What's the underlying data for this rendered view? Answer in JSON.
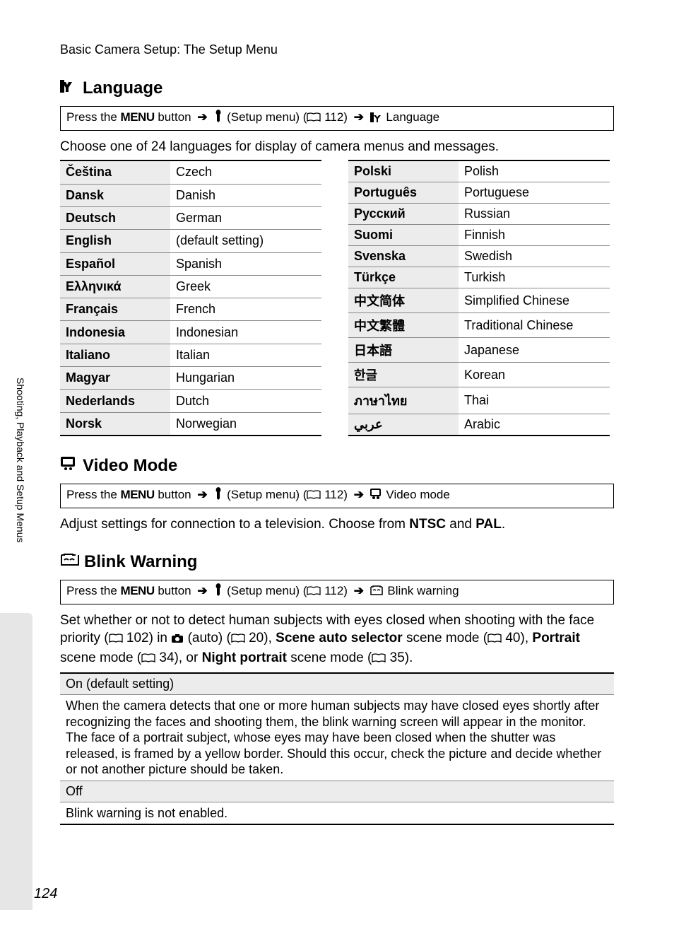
{
  "header": "Basic Camera Setup: The Setup Menu",
  "side_label": "Shooting, Playback and Setup Menus",
  "page_number": "124",
  "path_common": {
    "prefix": "Press the ",
    "menu_button_label": "MENU",
    "after_button": " button",
    "setup_label": "(Setup menu) (",
    "page_ref": "112",
    "after_ref": ")"
  },
  "language": {
    "title": "Language",
    "path_tail": "Language",
    "description": "Choose one of 24 languages for display of camera menus and messages.",
    "left": [
      {
        "native": "Čeština",
        "english": "Czech"
      },
      {
        "native": "Dansk",
        "english": "Danish"
      },
      {
        "native": "Deutsch",
        "english": "German"
      },
      {
        "native": "English",
        "english": "(default setting)"
      },
      {
        "native": "Español",
        "english": "Spanish"
      },
      {
        "native": "Ελληνικά",
        "english": "Greek"
      },
      {
        "native": "Français",
        "english": "French"
      },
      {
        "native": "Indonesia",
        "english": "Indonesian"
      },
      {
        "native": "Italiano",
        "english": "Italian"
      },
      {
        "native": "Magyar",
        "english": "Hungarian"
      },
      {
        "native": "Nederlands",
        "english": "Dutch"
      },
      {
        "native": "Norsk",
        "english": "Norwegian"
      }
    ],
    "right": [
      {
        "native": "Polski",
        "english": "Polish"
      },
      {
        "native": "Português",
        "english": "Portuguese"
      },
      {
        "native": "Русский",
        "english": "Russian"
      },
      {
        "native": "Suomi",
        "english": "Finnish"
      },
      {
        "native": "Svenska",
        "english": "Swedish"
      },
      {
        "native": "Türkçe",
        "english": "Turkish"
      },
      {
        "native": "中文简体",
        "english": "Simplified Chinese"
      },
      {
        "native": "中文繁體",
        "english": "Traditional Chinese"
      },
      {
        "native": "日本語",
        "english": "Japanese"
      },
      {
        "native": "한글",
        "english": "Korean"
      },
      {
        "native": "ภาษาไทย",
        "english": "Thai"
      },
      {
        "native": "عربي",
        "english": "Arabic"
      }
    ]
  },
  "video": {
    "title": "Video Mode",
    "path_tail": "Video mode",
    "description_pre": "Adjust settings for connection to a television. Choose from ",
    "opt1": "NTSC",
    "and": " and ",
    "opt2": "PAL",
    "period": "."
  },
  "blink": {
    "title": "Blink Warning",
    "path_tail": "Blink warning",
    "descr": {
      "p1a": "Set whether or not to detect human subjects with eyes closed when shooting with the face priority (",
      "ref1": "102",
      "p1b": ") in ",
      "p1c": " (auto) (",
      "ref2": "20",
      "p1d": "), ",
      "b1": "Scene auto selector",
      "p1e": " scene mode (",
      "ref3": "40",
      "p1f": "), ",
      "b2": "Portrait",
      "p1g": " scene mode (",
      "ref4": "34",
      "p1h": "), or ",
      "b3": "Night portrait",
      "p1i": " scene mode (",
      "ref5": "35",
      "p1j": ")."
    },
    "on_label": "On (default setting)",
    "on_desc": "When the camera detects that one or more human subjects may have closed eyes shortly after recognizing the faces and shooting them, the blink warning screen will appear in the monitor.\nThe face of a portrait subject, whose eyes may have been closed when the shutter was released, is framed by a yellow border. Should this occur, check the picture and decide whether or not another picture should be taken.",
    "off_label": "Off",
    "off_desc": "Blink warning is not enabled."
  }
}
